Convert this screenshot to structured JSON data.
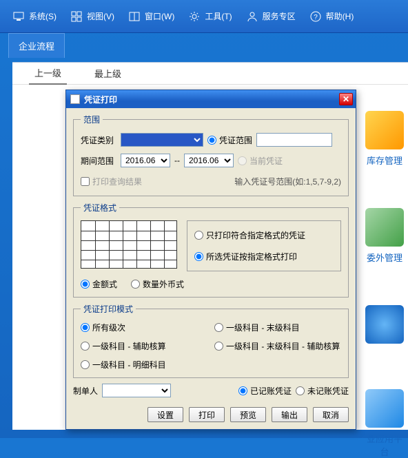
{
  "menubar": [
    {
      "icon": "monitor",
      "label": "系统(S)"
    },
    {
      "icon": "grid",
      "label": "视图(V)"
    },
    {
      "icon": "window",
      "label": "窗口(W)"
    },
    {
      "icon": "gear",
      "label": "工具(T)"
    },
    {
      "icon": "person",
      "label": "服务专区"
    },
    {
      "icon": "help",
      "label": "帮助(H)"
    }
  ],
  "tab_label": "企业流程",
  "crumbs": {
    "prev": "上一级",
    "top": "最上级"
  },
  "tiles": [
    {
      "label": "库存管理"
    },
    {
      "label": "委外管理"
    },
    {
      "label": ""
    },
    {
      "label": "业应用平台"
    }
  ],
  "dialog": {
    "title": "凭证打印",
    "scope": {
      "legend": "范围",
      "type_label": "凭证类别",
      "type_value": "",
      "range_radio": "凭证范围",
      "range_value": "",
      "period_label": "期间范围",
      "date_from": "2016.06",
      "date_to": "2016.06",
      "current_radio": "当前凭证",
      "query_chk": "打印查询结果",
      "hint": "输入凭证号范围(如:1,5,7-9,2)"
    },
    "format": {
      "legend": "凭证格式",
      "opt_a": "只打印符合指定格式的凭证",
      "opt_b": "所选凭证按指定格式打印",
      "style_amount": "金额式",
      "style_qtyfx": "数量外币式"
    },
    "mode": {
      "legend": "凭证打印模式",
      "m1": "所有级次",
      "m2": "一级科目 - 末级科目",
      "m3": "一级科目 - 辅助核算",
      "m4": "一级科目 - 末级科目 - 辅助核算",
      "m5": "一级科目 - 明细科目"
    },
    "preparer_label": "制单人",
    "preparer_value": "",
    "posted": "已记账凭证",
    "unposted": "未记账凭证",
    "buttons": {
      "set": "设置",
      "print": "打印",
      "preview": "预览",
      "export": "输出",
      "cancel": "取消"
    }
  }
}
